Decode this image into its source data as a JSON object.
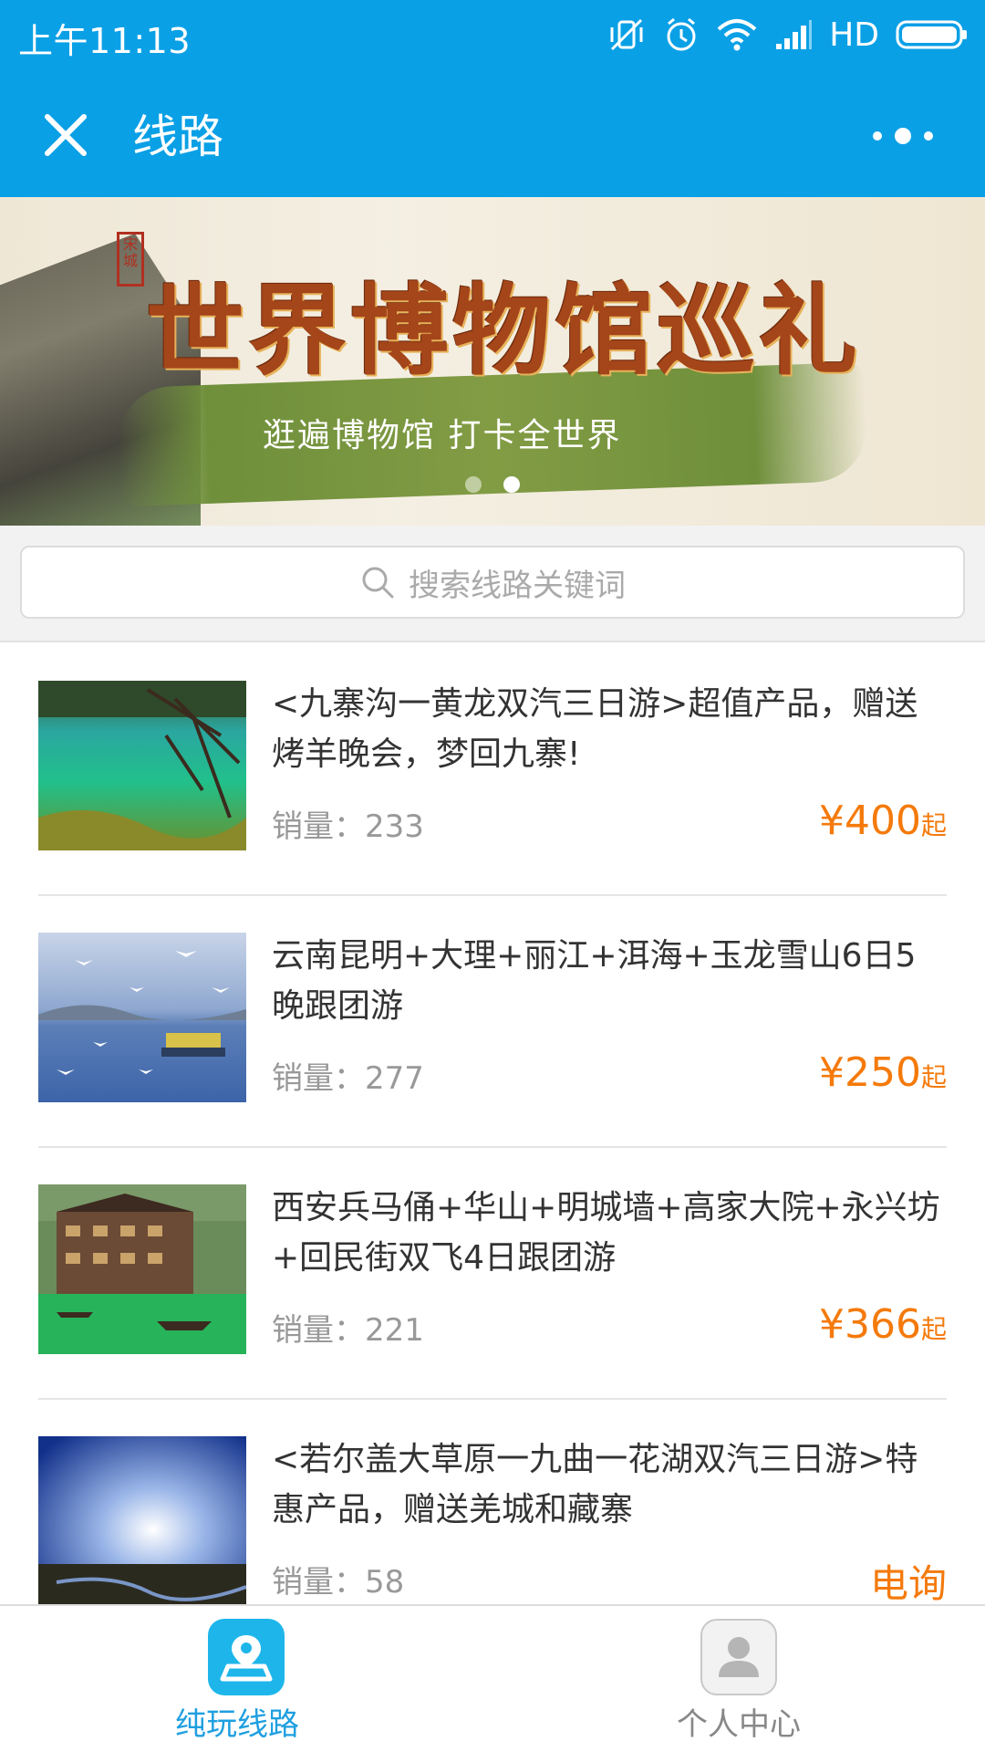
{
  "status_bar": {
    "time": "上午11:13",
    "network": "HD"
  },
  "header": {
    "title": "线路",
    "close_icon": "close-icon",
    "more_icon": "more-dots-icon"
  },
  "banner": {
    "title": "世界博物馆巡礼",
    "subtitle": "逛遍博物馆 打卡全世界",
    "stamp": "宋城",
    "slide_count": 2,
    "active_slide": 2
  },
  "search": {
    "placeholder": "搜索线路关键词",
    "icon": "search-icon"
  },
  "routes": [
    {
      "name": "<九寨沟一黄龙双汽三日游>超值产品，赠送烤羊晚会，梦回九寨!",
      "sales_label": "销量：233",
      "price": "¥400",
      "price_suffix": "起",
      "thumb": "lake-with-branches"
    },
    {
      "name": "云南昆明+大理+丽江+洱海+玉龙雪山6日5晚跟团游",
      "sales_label": "销量：277",
      "price": "¥250",
      "price_suffix": "起",
      "thumb": "seagulls-over-lake"
    },
    {
      "name": "西安兵马俑+华山+明城墙+高家大院+永兴坊+回民街双飞4日跟团游",
      "sales_label": "销量：221",
      "price": "¥366",
      "price_suffix": "起",
      "thumb": "river-town-with-boats"
    },
    {
      "name": "<若尔盖大草原一九曲一花湖双汽三日游>特惠产品，赠送羌城和藏寨",
      "sales_label": "销量：58",
      "price": "电询",
      "price_suffix": "",
      "thumb": "grassland-sky"
    }
  ],
  "tabbar": {
    "tabs": [
      {
        "label": "纯玩线路",
        "icon": "map-pin-icon",
        "active": true
      },
      {
        "label": "个人中心",
        "icon": "user-icon",
        "active": false
      }
    ]
  },
  "colors": {
    "primary": "#0aa0e6",
    "price": "#f57a0b",
    "tab_active": "#1e9fe0"
  }
}
